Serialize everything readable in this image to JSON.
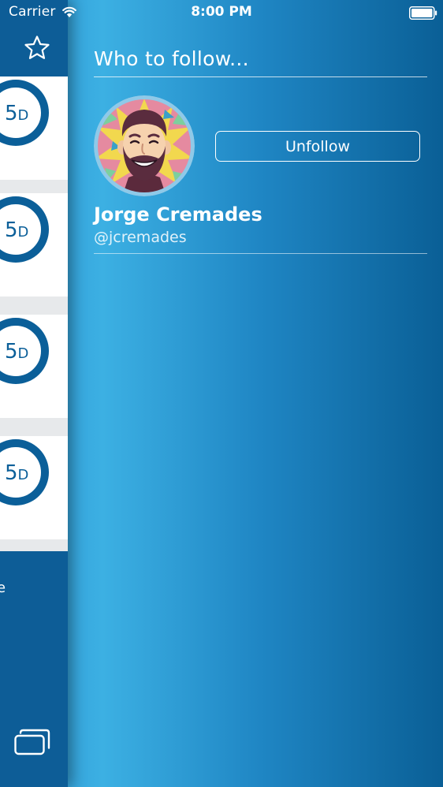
{
  "status_bar": {
    "carrier": "Carrier",
    "time": "8:00 PM"
  },
  "left_panel": {
    "badges": [
      {
        "number": "5",
        "unit": "D"
      },
      {
        "number": "5",
        "unit": "D"
      },
      {
        "number": "5",
        "unit": "D"
      },
      {
        "number": "5",
        "unit": "D"
      }
    ],
    "bottom_text": "e",
    "icons": {
      "header": "star-icon",
      "footer": "windows-icon"
    }
  },
  "main": {
    "section_title": "Who to follow...",
    "users": [
      {
        "name": "Jorge Cremades",
        "handle": "@jcremades",
        "button_label": "Unfollow"
      }
    ]
  },
  "colors": {
    "accent": "#0d5d97",
    "gradient_light": "#3cb0e3",
    "gradient_dark": "#0a5f96",
    "text": "#ffffff"
  }
}
